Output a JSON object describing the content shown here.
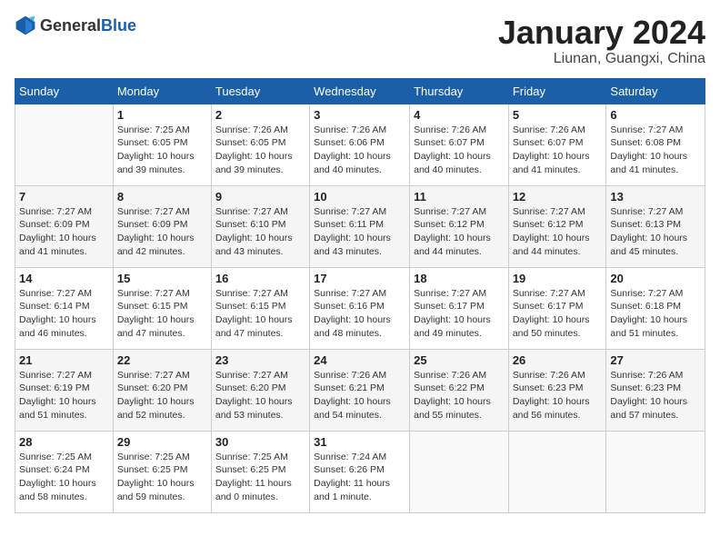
{
  "header": {
    "logo_general": "General",
    "logo_blue": "Blue",
    "month": "January 2024",
    "location": "Liunan, Guangxi, China"
  },
  "days_of_week": [
    "Sunday",
    "Monday",
    "Tuesday",
    "Wednesday",
    "Thursday",
    "Friday",
    "Saturday"
  ],
  "weeks": [
    [
      {
        "day": "",
        "info": ""
      },
      {
        "day": "1",
        "info": "Sunrise: 7:25 AM\nSunset: 6:05 PM\nDaylight: 10 hours\nand 39 minutes."
      },
      {
        "day": "2",
        "info": "Sunrise: 7:26 AM\nSunset: 6:05 PM\nDaylight: 10 hours\nand 39 minutes."
      },
      {
        "day": "3",
        "info": "Sunrise: 7:26 AM\nSunset: 6:06 PM\nDaylight: 10 hours\nand 40 minutes."
      },
      {
        "day": "4",
        "info": "Sunrise: 7:26 AM\nSunset: 6:07 PM\nDaylight: 10 hours\nand 40 minutes."
      },
      {
        "day": "5",
        "info": "Sunrise: 7:26 AM\nSunset: 6:07 PM\nDaylight: 10 hours\nand 41 minutes."
      },
      {
        "day": "6",
        "info": "Sunrise: 7:27 AM\nSunset: 6:08 PM\nDaylight: 10 hours\nand 41 minutes."
      }
    ],
    [
      {
        "day": "7",
        "info": "Sunrise: 7:27 AM\nSunset: 6:09 PM\nDaylight: 10 hours\nand 41 minutes."
      },
      {
        "day": "8",
        "info": "Sunrise: 7:27 AM\nSunset: 6:09 PM\nDaylight: 10 hours\nand 42 minutes."
      },
      {
        "day": "9",
        "info": "Sunrise: 7:27 AM\nSunset: 6:10 PM\nDaylight: 10 hours\nand 43 minutes."
      },
      {
        "day": "10",
        "info": "Sunrise: 7:27 AM\nSunset: 6:11 PM\nDaylight: 10 hours\nand 43 minutes."
      },
      {
        "day": "11",
        "info": "Sunrise: 7:27 AM\nSunset: 6:12 PM\nDaylight: 10 hours\nand 44 minutes."
      },
      {
        "day": "12",
        "info": "Sunrise: 7:27 AM\nSunset: 6:12 PM\nDaylight: 10 hours\nand 44 minutes."
      },
      {
        "day": "13",
        "info": "Sunrise: 7:27 AM\nSunset: 6:13 PM\nDaylight: 10 hours\nand 45 minutes."
      }
    ],
    [
      {
        "day": "14",
        "info": "Sunrise: 7:27 AM\nSunset: 6:14 PM\nDaylight: 10 hours\nand 46 minutes."
      },
      {
        "day": "15",
        "info": "Sunrise: 7:27 AM\nSunset: 6:15 PM\nDaylight: 10 hours\nand 47 minutes."
      },
      {
        "day": "16",
        "info": "Sunrise: 7:27 AM\nSunset: 6:15 PM\nDaylight: 10 hours\nand 47 minutes."
      },
      {
        "day": "17",
        "info": "Sunrise: 7:27 AM\nSunset: 6:16 PM\nDaylight: 10 hours\nand 48 minutes."
      },
      {
        "day": "18",
        "info": "Sunrise: 7:27 AM\nSunset: 6:17 PM\nDaylight: 10 hours\nand 49 minutes."
      },
      {
        "day": "19",
        "info": "Sunrise: 7:27 AM\nSunset: 6:17 PM\nDaylight: 10 hours\nand 50 minutes."
      },
      {
        "day": "20",
        "info": "Sunrise: 7:27 AM\nSunset: 6:18 PM\nDaylight: 10 hours\nand 51 minutes."
      }
    ],
    [
      {
        "day": "21",
        "info": "Sunrise: 7:27 AM\nSunset: 6:19 PM\nDaylight: 10 hours\nand 51 minutes."
      },
      {
        "day": "22",
        "info": "Sunrise: 7:27 AM\nSunset: 6:20 PM\nDaylight: 10 hours\nand 52 minutes."
      },
      {
        "day": "23",
        "info": "Sunrise: 7:27 AM\nSunset: 6:20 PM\nDaylight: 10 hours\nand 53 minutes."
      },
      {
        "day": "24",
        "info": "Sunrise: 7:26 AM\nSunset: 6:21 PM\nDaylight: 10 hours\nand 54 minutes."
      },
      {
        "day": "25",
        "info": "Sunrise: 7:26 AM\nSunset: 6:22 PM\nDaylight: 10 hours\nand 55 minutes."
      },
      {
        "day": "26",
        "info": "Sunrise: 7:26 AM\nSunset: 6:23 PM\nDaylight: 10 hours\nand 56 minutes."
      },
      {
        "day": "27",
        "info": "Sunrise: 7:26 AM\nSunset: 6:23 PM\nDaylight: 10 hours\nand 57 minutes."
      }
    ],
    [
      {
        "day": "28",
        "info": "Sunrise: 7:25 AM\nSunset: 6:24 PM\nDaylight: 10 hours\nand 58 minutes."
      },
      {
        "day": "29",
        "info": "Sunrise: 7:25 AM\nSunset: 6:25 PM\nDaylight: 10 hours\nand 59 minutes."
      },
      {
        "day": "30",
        "info": "Sunrise: 7:25 AM\nSunset: 6:25 PM\nDaylight: 11 hours\nand 0 minutes."
      },
      {
        "day": "31",
        "info": "Sunrise: 7:24 AM\nSunset: 6:26 PM\nDaylight: 11 hours\nand 1 minute."
      },
      {
        "day": "",
        "info": ""
      },
      {
        "day": "",
        "info": ""
      },
      {
        "day": "",
        "info": ""
      }
    ]
  ]
}
